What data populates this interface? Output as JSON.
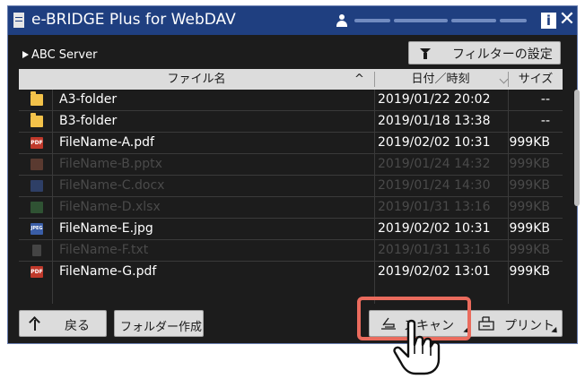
{
  "window": {
    "title": "e-BRIDGE Plus for WebDAV",
    "icons": {
      "app": "document-icon",
      "user": "user-icon",
      "info": "info-icon",
      "close": "close-icon"
    },
    "info_label": "i",
    "close_label": "✕"
  },
  "breadcrumb": {
    "label": "ABC Server"
  },
  "filter_button": {
    "label": "フィルターの設定",
    "icon": "filter-icon"
  },
  "table": {
    "columns": {
      "name": "ファイル名",
      "date": "日付／時刻",
      "size": "サイズ"
    },
    "sort_indicator": "^",
    "rows": [
      {
        "name": "A3-folder",
        "date": "2019/01/22 20:02",
        "size": "--",
        "type": "folder",
        "enabled": true
      },
      {
        "name": "B3-folder",
        "date": "2019/01/18 13:38",
        "size": "--",
        "type": "folder",
        "enabled": true
      },
      {
        "name": "FileName-A.pdf",
        "date": "2019/02/02 10:31",
        "size": "999KB",
        "type": "pdf",
        "enabled": true
      },
      {
        "name": "FileName-B.pptx",
        "date": "2019/01/24 14:32",
        "size": "999KB",
        "type": "pptx",
        "enabled": false
      },
      {
        "name": "FileName-C.docx",
        "date": "2019/01/24 14:30",
        "size": "999KB",
        "type": "docx",
        "enabled": false
      },
      {
        "name": "FileName-D.xlsx",
        "date": "2019/01/31 13:16",
        "size": "999KB",
        "type": "xlsx",
        "enabled": false
      },
      {
        "name": "FileName-E.jpg",
        "date": "2019/02/02 10:31",
        "size": "999KB",
        "type": "jpeg",
        "enabled": true
      },
      {
        "name": "FileName-F.txt",
        "date": "2019/01/31 13:16",
        "size": "999KB",
        "type": "txt",
        "enabled": false
      },
      {
        "name": "FileName-G.pdf",
        "date": "2019/02/02 13:01",
        "size": "999KB",
        "type": "pdf",
        "enabled": true
      }
    ]
  },
  "bottom": {
    "back_label": "戻る",
    "new_folder_label": "フォルダー作成",
    "scan_label": "スキャン",
    "print_label": "プリント"
  },
  "colors": {
    "title_bar": "#1f3f80",
    "background": "#1c1c1c",
    "button": "#dcdcdc",
    "highlight": "#ea6b5d",
    "folder": "#f3c24a",
    "pdf": "#c0392b",
    "jpeg": "#3a5ea8"
  }
}
